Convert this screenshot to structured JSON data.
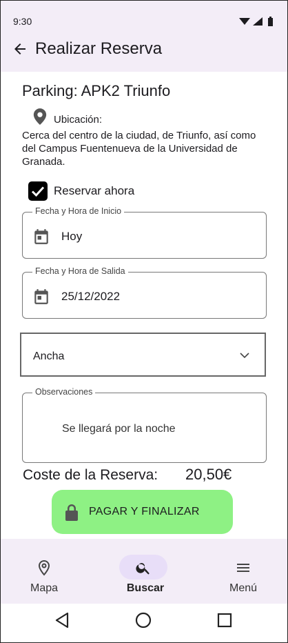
{
  "status_bar": {
    "time": "9:30",
    "icons": [
      "wifi-icon",
      "signal-icon",
      "battery-icon"
    ]
  },
  "app_bar": {
    "title": "Realizar Reserva",
    "back_icon": "arrow-back-icon"
  },
  "parking": {
    "title": "Parking: APK2 Triunfo",
    "location_label": "Ubicación:",
    "location_text": "Cerca del centro de la ciudad, de Triunfo, así como del Campus Fuentenueva de la Universidad de Granada."
  },
  "reserve_now": {
    "label": "Reservar ahora",
    "checked": true
  },
  "start_field": {
    "label": "Fecha y Hora de Inicio",
    "value": "Hoy"
  },
  "end_field": {
    "label": "Fecha y Hora de Salida",
    "value": "25/12/2022"
  },
  "vehicle_select": {
    "value": "Ancha"
  },
  "observations": {
    "label": "Observaciones",
    "value": "Se llegará por la noche"
  },
  "cost": {
    "label": "Coste de la Reserva:",
    "value": "20,50€"
  },
  "pay_button": {
    "label": "PAGAR Y FINALIZAR"
  },
  "bottom_nav": {
    "items": [
      {
        "label": "Mapa",
        "icon": "location-pin-icon"
      },
      {
        "label": "Buscar",
        "icon": "search-icon",
        "active": true
      },
      {
        "label": "Menú",
        "icon": "menu-icon"
      }
    ]
  },
  "colors": {
    "app_bar_bg": "#f3edf7",
    "pay_button_bg": "#8ef184",
    "active_indicator": "#e8def8"
  }
}
